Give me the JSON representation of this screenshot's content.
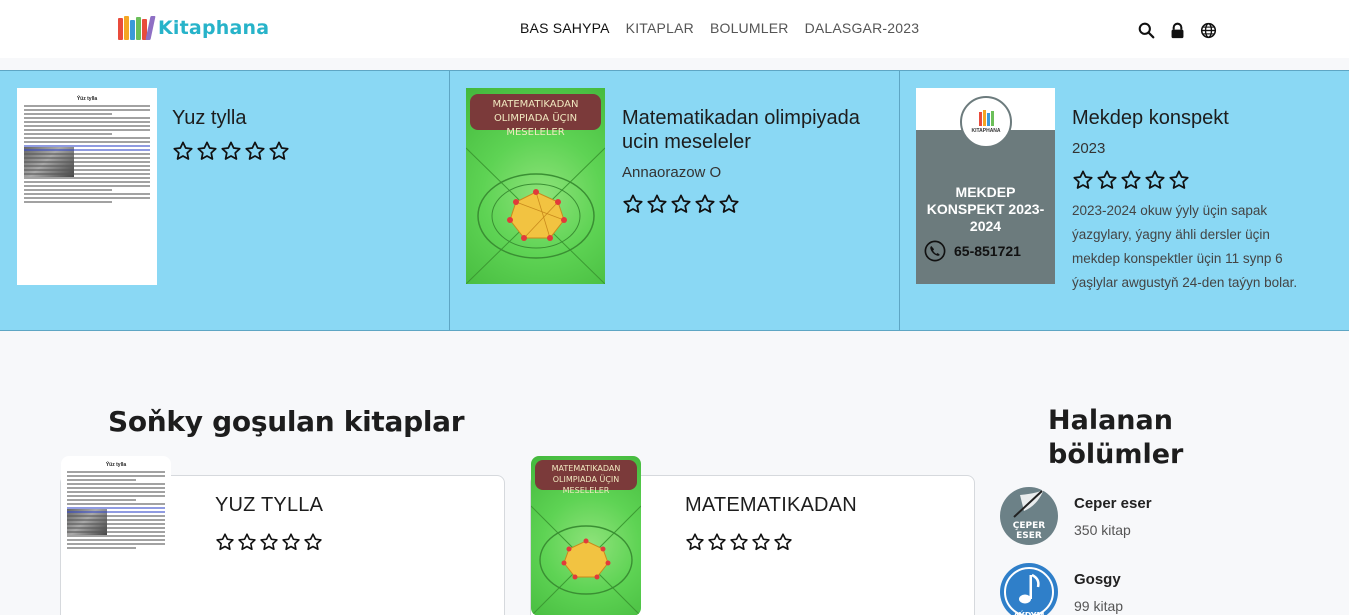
{
  "brand": {
    "name": "Kitaphana"
  },
  "nav": {
    "links": [
      "BAS SAHYPA",
      "KITAPLAR",
      "BOLUMLER",
      "DALASGAR-2023"
    ],
    "icons": [
      "search-icon",
      "lock-icon",
      "globe-icon"
    ]
  },
  "featured": [
    {
      "title": "Yuz tylla",
      "rating": 0,
      "cover_page_title": "Ýüz tylla"
    },
    {
      "title": "Matematikadan olimpiyada ucin meseleler",
      "author": "Annaorazow O",
      "rating": 0,
      "cover_label": "MATEMATIKADAN OLIMPIADA ÜÇIN MESELELER"
    },
    {
      "title": "Mekdep konspekt",
      "year": "2023",
      "rating": 0,
      "description": "2023-2024 okuw ýyly üçin sapak ýazgylary, ýagny ähli dersler üçin mekdep konspektler üçin 11 synp 6 ýaşlylar awgustyň 24-den taýyn bolar.",
      "cover_brand": "KITAPHANA",
      "cover_title": "MEKDEP KONSPEKT 2023-2024",
      "cover_phone": "65-851721"
    }
  ],
  "recent": {
    "title": "Soňky goşulan kitaplar",
    "books": [
      {
        "title": "YUZ TYLLA",
        "rating": 0
      },
      {
        "title": "MATEMATIKADAN",
        "rating": 0
      }
    ]
  },
  "sidebar": {
    "title": "Halanan bölümler",
    "categories": [
      {
        "name": "Ceper eser",
        "count": "350 kitap",
        "icon_text": "ÇEPER ESER"
      },
      {
        "name": "Gosgy",
        "count": "99 kitap",
        "icon_text": "AYDYM"
      }
    ]
  },
  "colors": {
    "accent": "#27b3c9",
    "featured_bg": "#8ad8f4",
    "page_bg": "#f7f8fa"
  }
}
